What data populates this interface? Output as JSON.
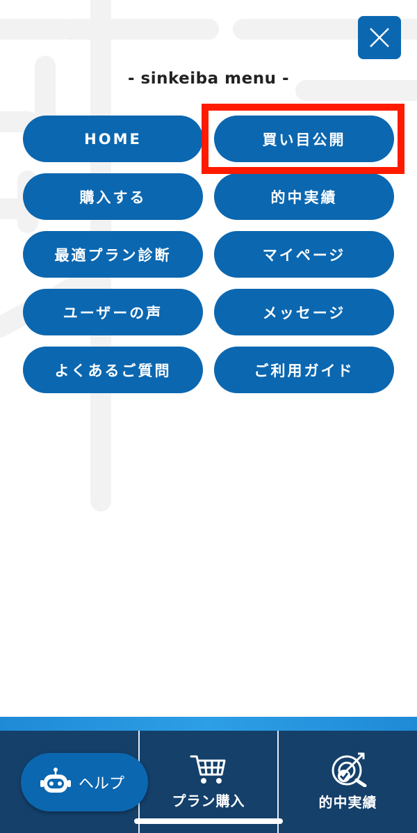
{
  "header": {
    "close_icon": "close-icon",
    "menu_title": "- sinkeiba menu -"
  },
  "menu": {
    "items": [
      {
        "label": "HOME"
      },
      {
        "label": "買い目公開"
      },
      {
        "label": "購入する"
      },
      {
        "label": "的中実績"
      },
      {
        "label": "最適プラン診断"
      },
      {
        "label": "マイページ"
      },
      {
        "label": "ユーザーの声"
      },
      {
        "label": "メッセージ"
      },
      {
        "label": "よくあるご質問"
      },
      {
        "label": "ご利用ガイド"
      }
    ],
    "highlighted": "買い目公開"
  },
  "bottom_nav": {
    "items": [
      {
        "label": "プラン購入",
        "icon": "cart-icon"
      },
      {
        "label": "的中実績",
        "icon": "target-icon"
      }
    ]
  },
  "help": {
    "label": "ヘルプ",
    "icon": "robot-icon"
  },
  "colors": {
    "primary": "#0b67b0",
    "bottom_bar": "#14406a",
    "highlight": "#ff1a00"
  }
}
